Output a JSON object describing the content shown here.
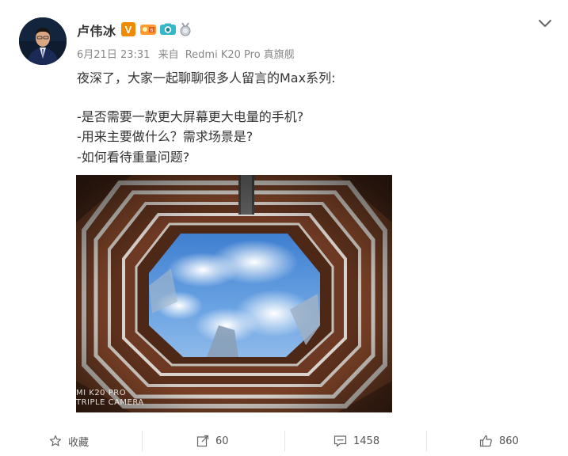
{
  "post": {
    "author": "卢伟冰",
    "date": "6月21日 23:31",
    "source_prefix": "来自",
    "source": "Redmi K20 Pro 真旗舰",
    "lines": [
      "夜深了，大家一起聊聊很多人留言的Max系列:",
      "-是否需要一款更大屏幕更大电量的手机?",
      "-用来主要做什么？需求场景是?",
      "-如何看待重量问题?"
    ],
    "badges": [
      "verified-v-badge",
      "vip-badge",
      "camera-badge",
      "medal-badge"
    ],
    "image": {
      "watermark_line1": "MI K20 PRO",
      "watermark_line2": "TRIPLE CAMERA"
    }
  },
  "actions": {
    "favorite": "收藏",
    "repost": "60",
    "comment": "1458",
    "like": "860"
  },
  "colors": {
    "verified": "#f08a00",
    "text": "#333333",
    "meta": "#888888"
  }
}
